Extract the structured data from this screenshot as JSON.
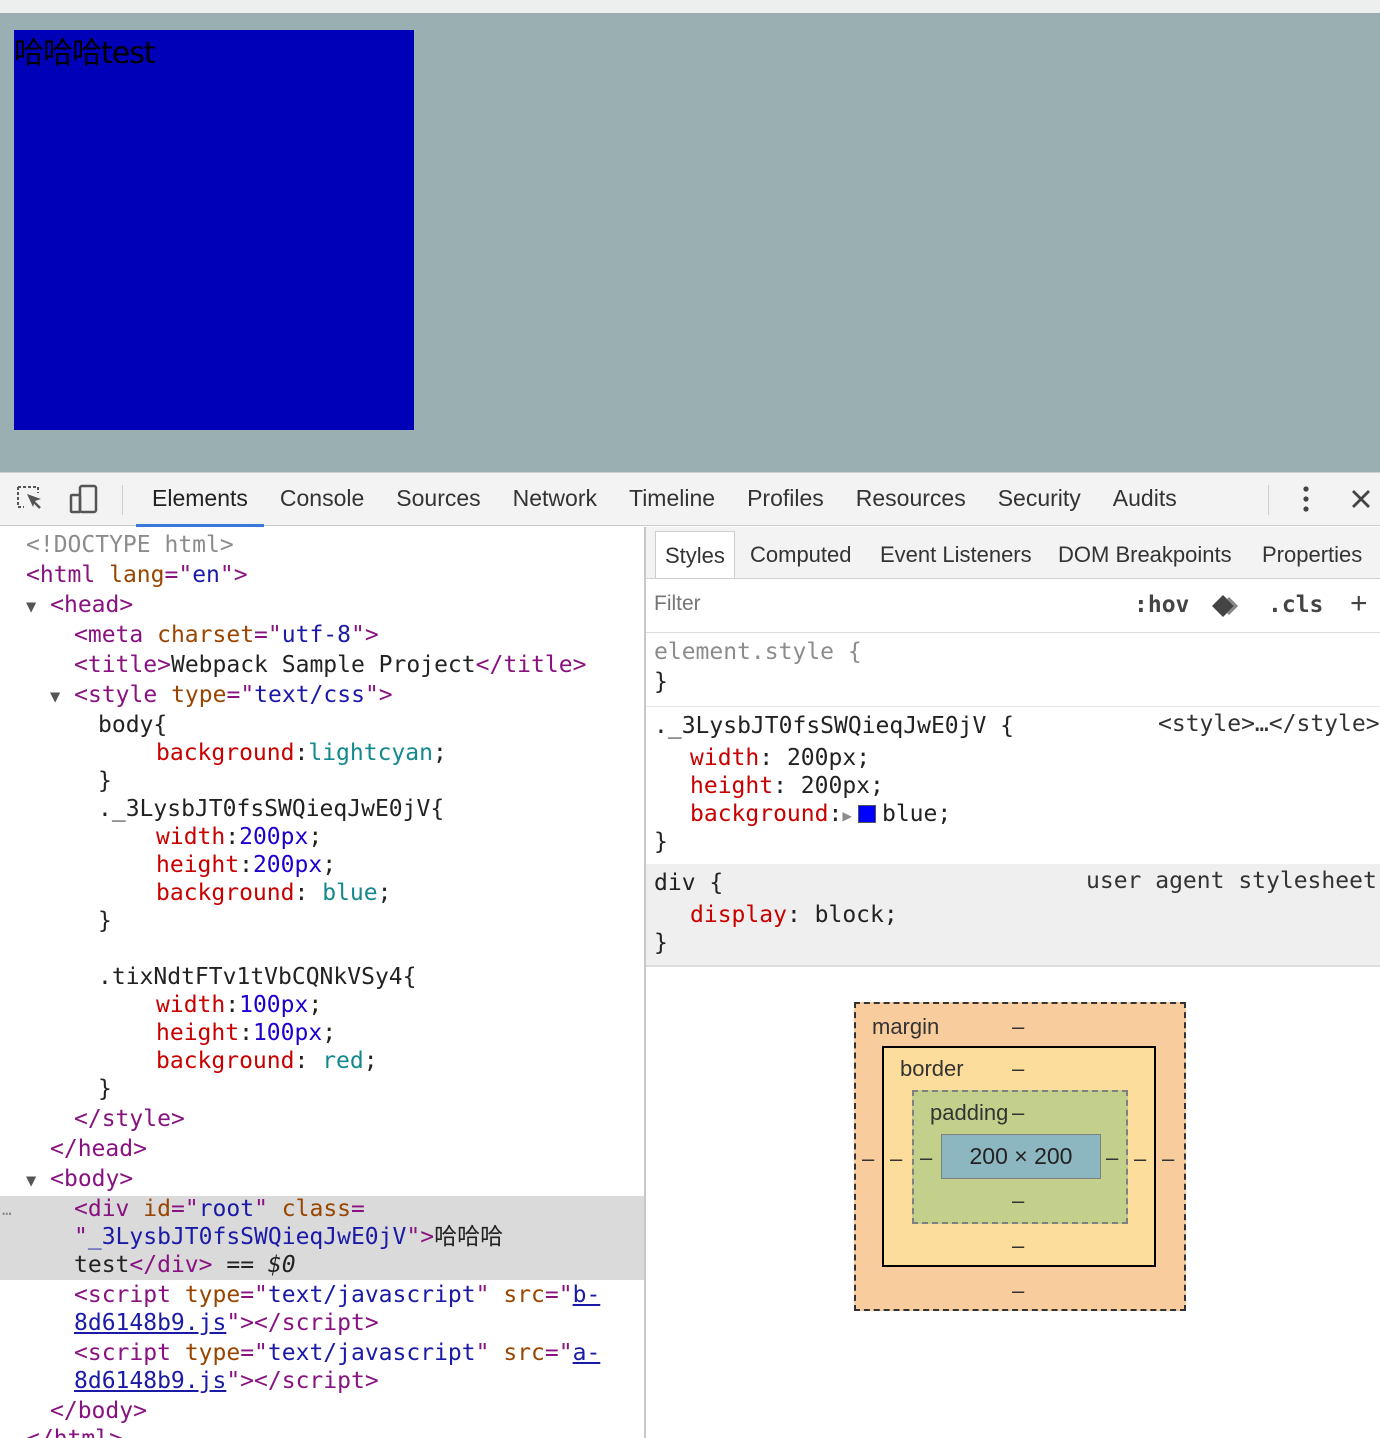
{
  "viewport": {
    "box_text": "哈哈哈test",
    "page_background": "#9aafb1",
    "box_color": "#0000b8"
  },
  "toolbar": {
    "tabs": [
      "Elements",
      "Console",
      "Sources",
      "Network",
      "Timeline",
      "Profiles",
      "Resources",
      "Security",
      "Audits"
    ],
    "active_tab": "Elements",
    "icons": [
      "inspect-icon",
      "device-mode-icon",
      "more-options-icon",
      "close-icon"
    ]
  },
  "dom": {
    "doctype": "<!DOCTYPE html>",
    "html_tag": "html",
    "lang_attr": "lang",
    "lang_val": "en",
    "head": "head",
    "meta": "meta",
    "charset_attr": "charset",
    "charset_val": "utf-8",
    "title": "title",
    "title_text": "Webpack Sample Project",
    "style": "style",
    "type_attr": "type",
    "style_type": "text/css",
    "css_body_sel": "body{",
    "css_background": "background",
    "css_lightcyan": "lightcyan",
    "close_brace": "}",
    "css_class1": "._3LysbJT0fsSWQieqJwE0jV{",
    "css_width": "width",
    "css_height": "height",
    "css_200px": "200px",
    "css_blue": "blue",
    "css_class2": ".tixNdtFTv1tVbCQNkVSy4{",
    "css_100px": "100px",
    "css_red": "red",
    "body": "body",
    "div": "div",
    "id_attr": "id",
    "id_val": "root",
    "class_attr": "class",
    "class_val": "_3LysbJT0fsSWQieqJwE0jV",
    "div_text_1": "哈哈哈",
    "div_text_2": "test",
    "dollar0": "== $0",
    "script": "script",
    "script_type": "text/javascript",
    "src_attr": "src",
    "src_b_1": "b-",
    "src_b_2": "8d6148b9.js",
    "src_a_1": "a-",
    "src_a_2": "8d6148b9.js",
    "more_dots": "…"
  },
  "styles": {
    "sub_tabs": [
      "Styles",
      "Computed",
      "Event Listeners",
      "DOM Breakpoints",
      "Properties"
    ],
    "filter_placeholder": "Filter",
    "hov": ":hov",
    "cls": ".cls",
    "plus": "+",
    "element_style": "element.style {",
    "close_brace": "}",
    "rule1_selector": "._3LysbJT0fsSWQieqJwE0jV {",
    "rule1_source": "<style>…</style>",
    "prop_width": "width",
    "prop_height": "height",
    "prop_background": "background",
    "val_200px": "200px;",
    "val_blue": "blue;",
    "swatch_color": "#0000ff",
    "rule2_selector": "div {",
    "rule2_source": "user agent stylesheet",
    "prop_display": "display",
    "val_block": "block;"
  },
  "box_model": {
    "margin_label": "margin",
    "border_label": "border",
    "padding_label": "padding",
    "content_size": "200 × 200",
    "dash": "–"
  }
}
